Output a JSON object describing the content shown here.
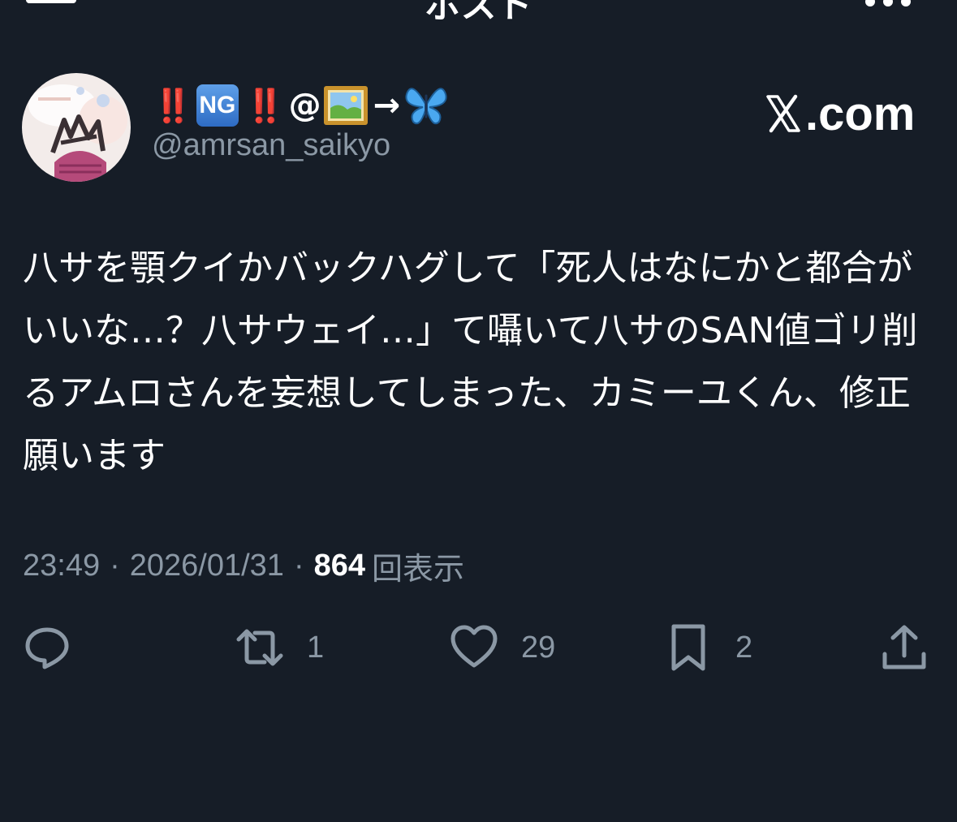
{
  "header": {
    "title": "ポスト",
    "back_icon": "arrow-left-icon",
    "more_icon": "more-dots-icon"
  },
  "author": {
    "display_name": {
      "bang": "‼️",
      "ng": "NG",
      "at": "@",
      "arrow": "→"
    },
    "handle": "@amrsan_saikyo",
    "avatar_icon": "profile-avatar"
  },
  "source": {
    "label": ".com",
    "logo_icon": "x-logo-icon"
  },
  "post": {
    "text": "八サを顎クイかバックハグして「死人はなにかと都合がいいな…？八サウェイ…」て囁いて八サのSAN値ゴリ削るアムロさんを妄想してしまった、カミーユくん、修正願います"
  },
  "meta": {
    "time": "23:49",
    "separator": "·",
    "date": "2026/01/31",
    "views_count": "864",
    "views_label": "回表示"
  },
  "actions": {
    "reply": {
      "icon": "reply-icon",
      "count": ""
    },
    "repost": {
      "icon": "repost-icon",
      "count": "1"
    },
    "like": {
      "icon": "heart-icon",
      "count": "29"
    },
    "bookmark": {
      "icon": "bookmark-icon",
      "count": "2"
    },
    "share": {
      "icon": "share-icon",
      "count": ""
    }
  },
  "colors": {
    "background": "#161d27",
    "text": "#ffffff",
    "muted": "#8b98a5",
    "bang_red": "#e0242b",
    "butterfly_blue": "#4aa8f0"
  }
}
